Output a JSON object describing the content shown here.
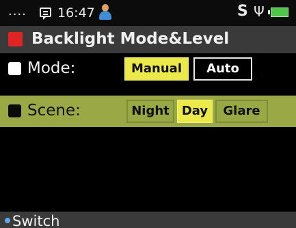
{
  "status_bar": {
    "signal_dots": "....",
    "time": "16:47",
    "sync_indicator": "S",
    "icons": [
      "message-icon",
      "user-icon",
      "usb-icon",
      "battery-icon"
    ],
    "usb_glyph": "Ψ"
  },
  "header": {
    "title": "Backlight Mode&Level",
    "accent_color": "#e02424"
  },
  "settings": {
    "mode": {
      "label": "Mode:",
      "options": [
        {
          "label": "Manual",
          "selected": true
        },
        {
          "label": "Auto",
          "selected": false
        }
      ]
    },
    "scene": {
      "label": "Scene:",
      "focused": true,
      "options": [
        {
          "label": "Night",
          "selected": false
        },
        {
          "label": "Day",
          "selected": true
        },
        {
          "label": "Glare",
          "selected": false
        }
      ]
    }
  },
  "softkey": {
    "label": "Switch"
  },
  "colors": {
    "selected_option": "#ece94a",
    "focused_row": "#9aa845",
    "bar_background": "#3a3a3a"
  }
}
